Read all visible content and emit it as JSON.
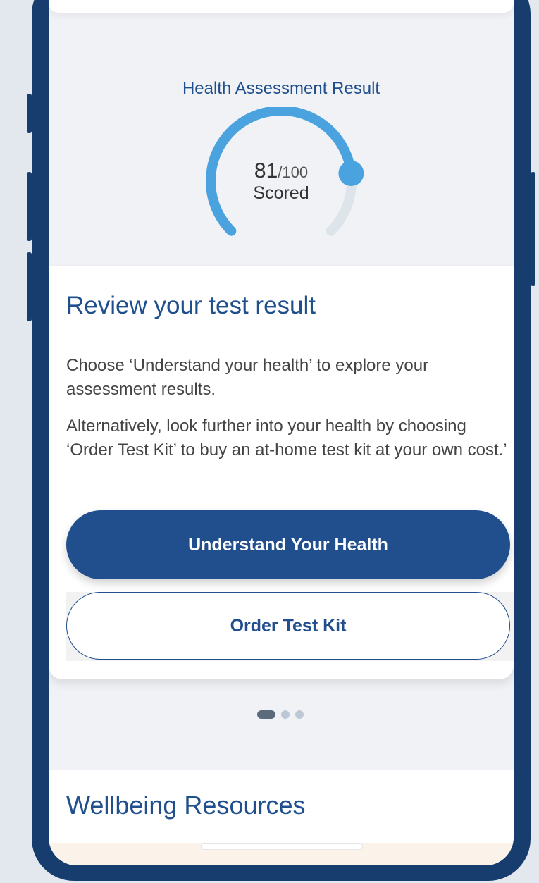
{
  "score_section": {
    "title": "Health Assessment Result",
    "score": "81",
    "max": "/100",
    "score_value": 81,
    "score_max": 100,
    "sublabel": "Scored",
    "accent_color": "#4aa3df",
    "track_color": "#dde4ea"
  },
  "card": {
    "title": "Review your test result",
    "paragraph1": "Choose ‘Understand your health’ to explore your assessment results.",
    "paragraph2": "Alternatively, look further into your health by choosing ‘Order Test Kit’ to buy an at-home test kit at your own cost.’",
    "primary_button": "Understand Your Health",
    "secondary_button": "Order Test Kit"
  },
  "pager": {
    "count": 3,
    "active": 0
  },
  "wellbeing": {
    "title": "Wellbeing Resources"
  },
  "colors": {
    "brand": "#214e8d",
    "frame": "#173d6e"
  }
}
